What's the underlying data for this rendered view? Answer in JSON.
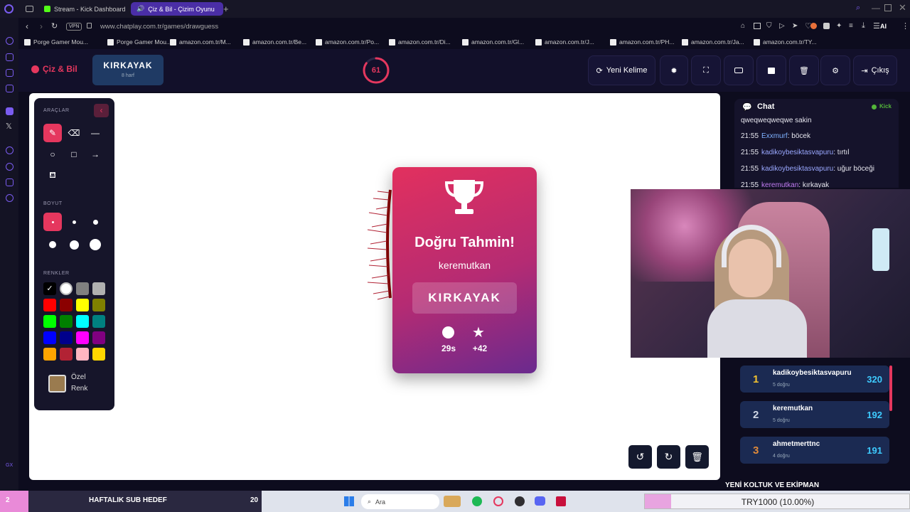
{
  "browser": {
    "tabs": [
      {
        "label": "Stream - Kick Dashboard",
        "active": false
      },
      {
        "label": "Çiz & Bil - Çizim Oyunu",
        "active": true
      }
    ],
    "vpn": "VPN",
    "url": "www.chatplay.com.tr/games/drawguess",
    "ai": "AI",
    "bookmarks": [
      "Porge Gamer Mou...",
      "Porge Gamer Mou...",
      "amazon.com.tr/M...",
      "amazon.com.tr/Be...",
      "amazon.com.tr/Po...",
      "amazon.com.tr/Di...",
      "amazon.com.tr/Gl...",
      "amazon.com.tr/J...",
      "amazon.com.tr/PH...",
      "amazon.com.tr/Ja...",
      "amazon.com.tr/TY..."
    ]
  },
  "app": {
    "logo": "Çiz & Bil",
    "word": "KIRKAYAK",
    "word_hint": "8 harf",
    "timer": "61",
    "timer_fraction": 0.85,
    "new_word": "Yeni Kelime",
    "exit": "Çıkış"
  },
  "tools": {
    "tools_title": "ARAÇLAR",
    "size_title": "BOYUT",
    "colors_title": "RENKLER",
    "custom_color": "Özel",
    "custom_color2": "Renk",
    "colors": [
      "#000000",
      "#ffffff",
      "#808080",
      "#b0b0b0",
      "#ff0000",
      "#8b0000",
      "#ffff00",
      "#808000",
      "#00ff00",
      "#008000",
      "#00ffff",
      "#008080",
      "#0000ff",
      "#00008b",
      "#ff00ff",
      "#800080",
      "#ffa500",
      "#b22234",
      "#ffb6c1",
      "#ffd700"
    ],
    "custom_swatch": "#9a7b4f"
  },
  "modal": {
    "title": "Doğru Tahmin!",
    "player": "keremutkan",
    "answer": "KIRKAYAK",
    "time": "29s",
    "points": "+42"
  },
  "chat": {
    "title": "Chat",
    "platform": "Kick",
    "messages": [
      {
        "time": "",
        "user": "",
        "text": "qweqweqweqwe sakin"
      },
      {
        "time": "21:55",
        "user": "Exxmurf",
        "text": ": böcek"
      },
      {
        "time": "21:55",
        "user": "kadikoybesiktasvapuru",
        "text": ": tırtıl"
      },
      {
        "time": "21:55",
        "user": "kadikoybesiktasvapuru",
        "text": ": uğur böceği"
      },
      {
        "time": "21:55",
        "user": "keremutkan",
        "text": ": kırkayak"
      }
    ]
  },
  "leaderboard": [
    {
      "rank": "1",
      "name": "kadikoybesiktasvapuru",
      "sub": "5 doğru",
      "score": "320"
    },
    {
      "rank": "2",
      "name": "keremutkan",
      "sub": "5 doğru",
      "score": "192"
    },
    {
      "rank": "3",
      "name": "ahmetmerttnc",
      "sub": "4 doğru",
      "score": "191"
    }
  ],
  "overlay": {
    "banner": "YENİ KOLTUK VE EKİPMAN",
    "sub_goal": "HAFTALIK SUB HEDEF",
    "sub_count": "20",
    "left_num": "2",
    "donation": "TRY1000 (10.00%)",
    "donation_fraction": 0.1,
    "search": "Ara"
  }
}
